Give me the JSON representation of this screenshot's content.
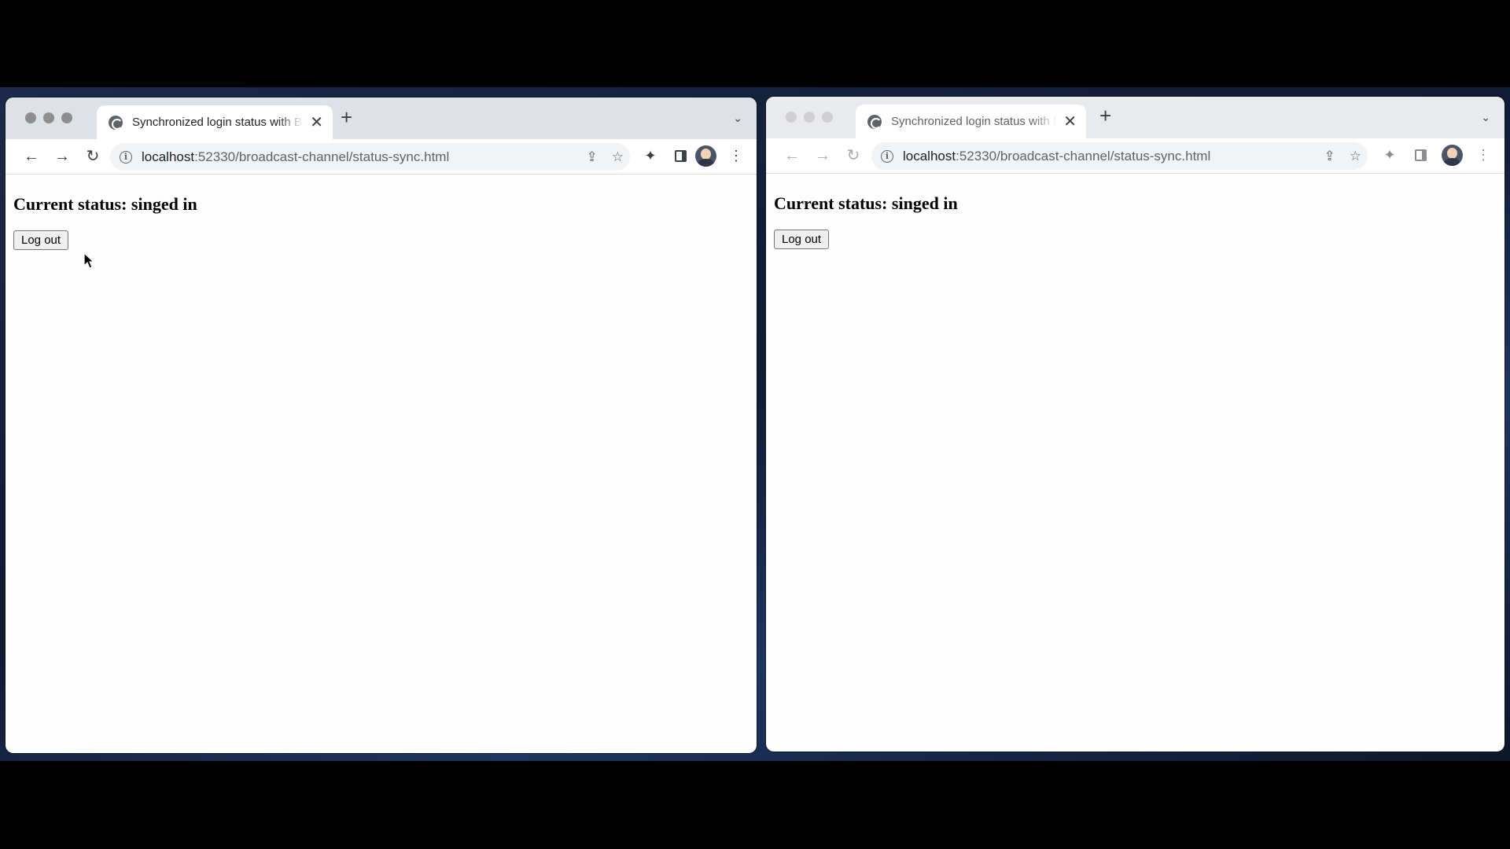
{
  "windows": {
    "left": {
      "tab_title": "Synchronized login status with BroadcastChannel",
      "url_host": "localhost",
      "url_path": ":52330/broadcast-channel/status-sync.html",
      "heading": "Current status: singed in",
      "button_label": "Log out"
    },
    "right": {
      "tab_title": "Synchronized login status with BroadcastChannel",
      "url_host": "localhost",
      "url_path": ":52330/broadcast-channel/status-sync.html",
      "heading": "Current status: singed in",
      "button_label": "Log out"
    }
  },
  "icons": {
    "back": "back-arrow-icon",
    "forward": "forward-arrow-icon",
    "reload": "reload-icon",
    "info": "info-icon",
    "share": "share-icon",
    "bookmark": "star-icon",
    "extensions": "puzzle-icon",
    "side_panel": "side-panel-icon",
    "menu": "kebab-menu-icon"
  }
}
